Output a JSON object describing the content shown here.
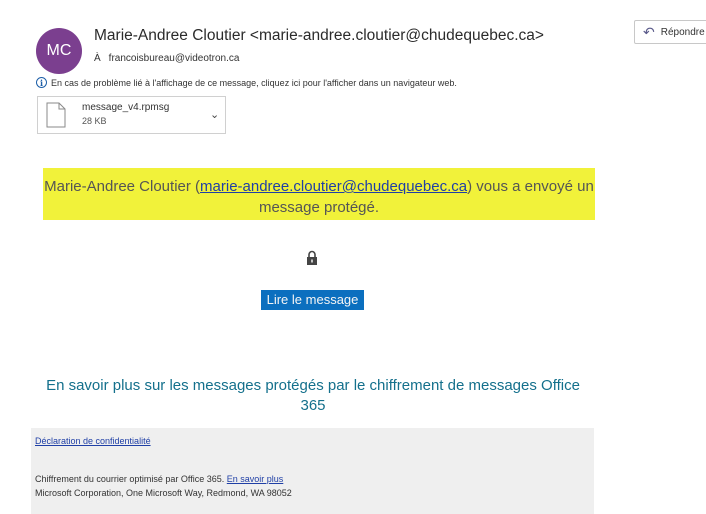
{
  "header": {
    "avatar_initials": "MC",
    "avatar_color": "#7b3f8f",
    "sender": "Marie-Andree Cloutier <marie-andree.cloutier@chudequebec.ca>",
    "to_prefix": "À",
    "to_address": "francoisbureau@videotron.ca",
    "reply_label": "Répondre",
    "reply_icon": "reply-arrow-icon"
  },
  "info_bar": {
    "icon": "info-icon",
    "text": "En cas de problème lié à l'affichage de ce message, cliquez ici pour l'afficher dans un navigateur web."
  },
  "attachment": {
    "name": "message_v4.rpmsg",
    "size": "28 KB",
    "icon": "file-icon"
  },
  "body": {
    "notice_prefix": "Marie-Andree Cloutier (",
    "notice_link": "marie-andree.cloutier@chudequebec.ca",
    "notice_suffix": ") vous a envoyé un message protégé.",
    "highlight_color": "#f1f23a",
    "lock_icon": "lock-icon",
    "read_button": "Lire le message",
    "learn_more": "En savoir plus sur les messages protégés par le chiffrement de messages Office 365"
  },
  "footer": {
    "privacy_link": "Déclaration de confidentialité",
    "encryption_text": "Chiffrement du courrier optimisé par Office 365.",
    "encryption_link": "En savoir plus",
    "address": "Microsoft Corporation, One Microsoft Way, Redmond, WA 98052"
  }
}
